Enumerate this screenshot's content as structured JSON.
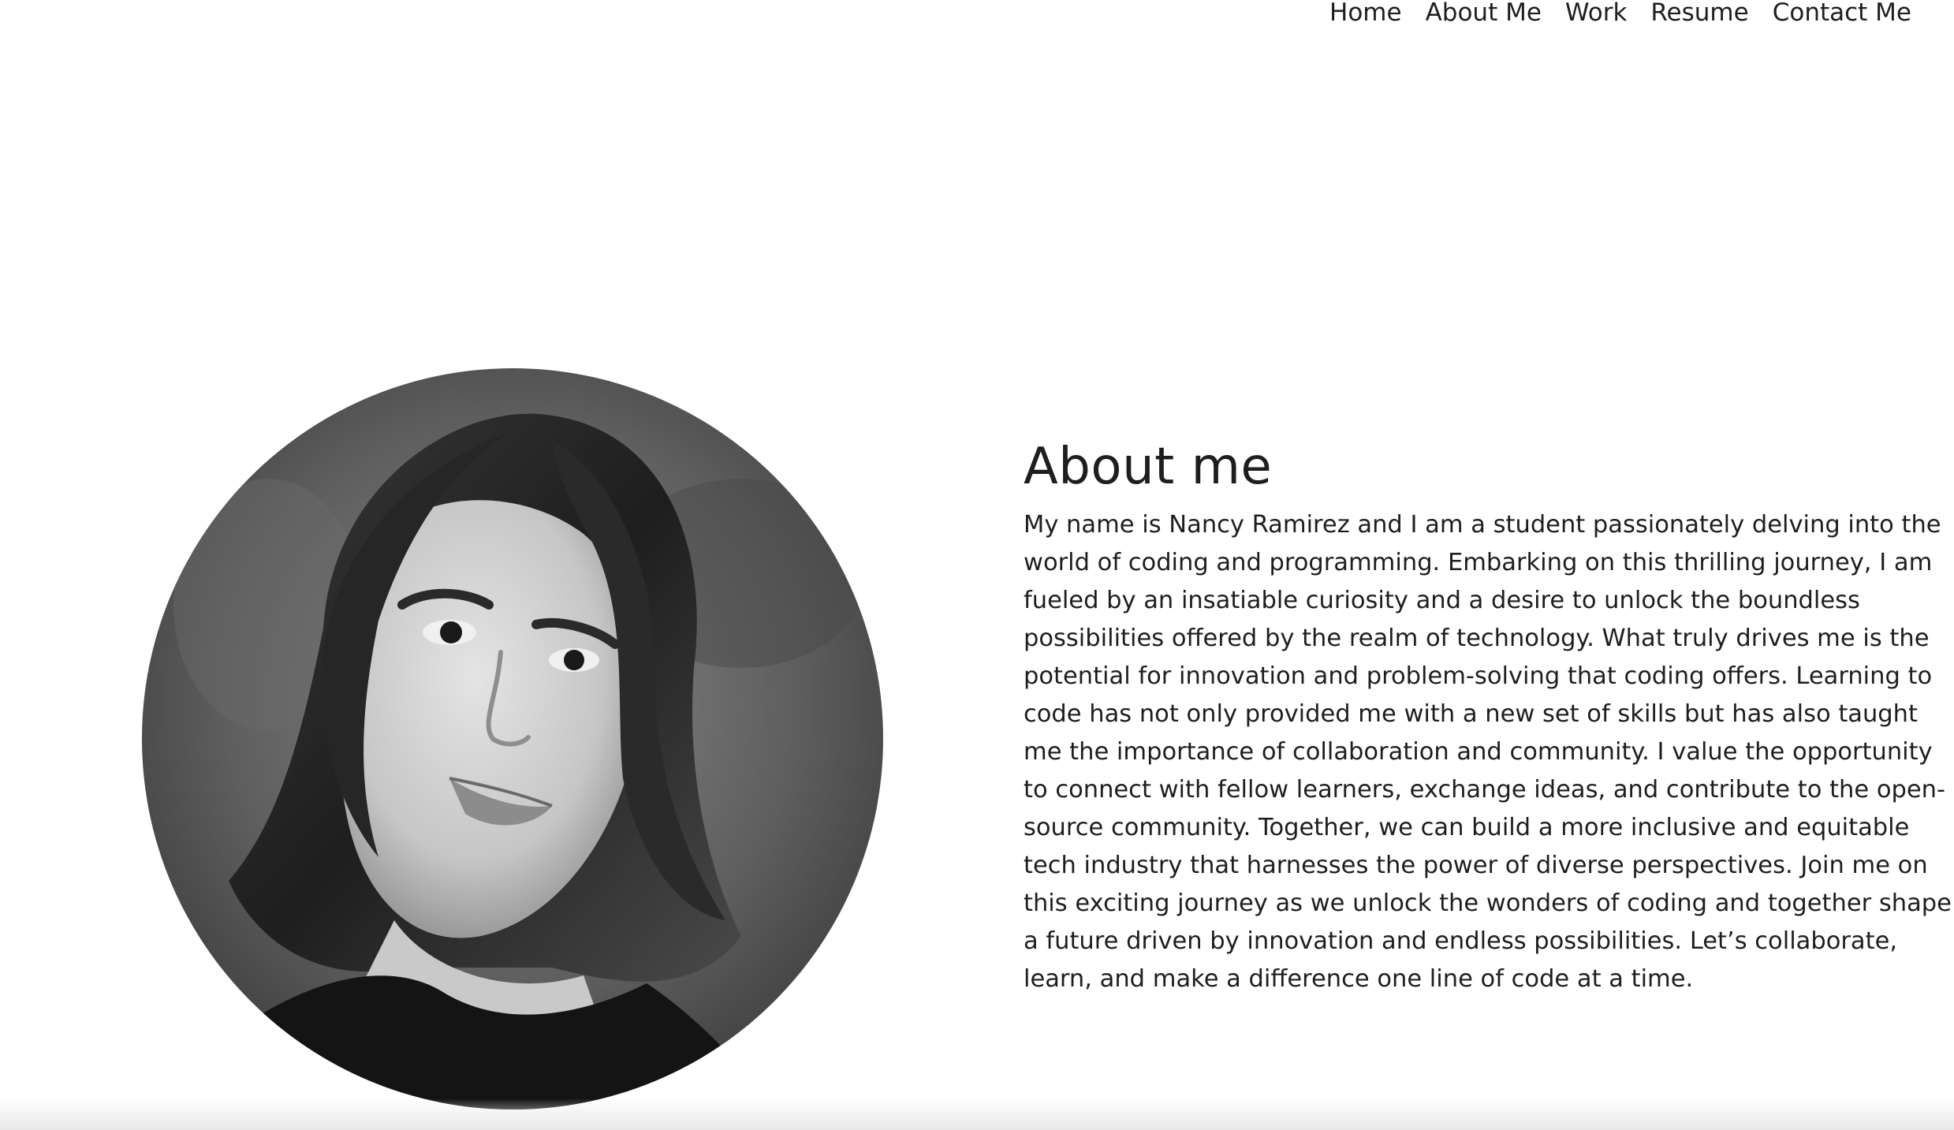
{
  "nav": {
    "items": [
      {
        "label": "Home"
      },
      {
        "label": "About Me"
      },
      {
        "label": "Work"
      },
      {
        "label": "Resume"
      },
      {
        "label": "Contact Me"
      }
    ]
  },
  "about": {
    "title": "About me",
    "body": "My name is Nancy Ramirez and I am a student passionately delving into the world of coding and programming. Embarking on this thrilling journey, I am fueled by an insatiable curiosity and a desire to unlock the boundless possibilities offered by the realm of technology. What truly drives me is the potential for innovation and problem-solving that coding offers. Learning to code has not only provided me with a new set of skills but has also taught me the importance of collaboration and community. I value the opportunity to connect with fellow learners, exchange ideas, and contribute to the open-source community. Together, we can build a more inclusive and equitable tech industry that harnesses the power of diverse perspectives. Join me on this exciting journey as we unlock the wonders of coding and together shape a future driven by innovation and endless possibilities. Let’s collaborate, learn, and make a difference one line of code at a time."
  },
  "colors": {
    "text": "#1e1e1e",
    "background": "#ffffff"
  }
}
